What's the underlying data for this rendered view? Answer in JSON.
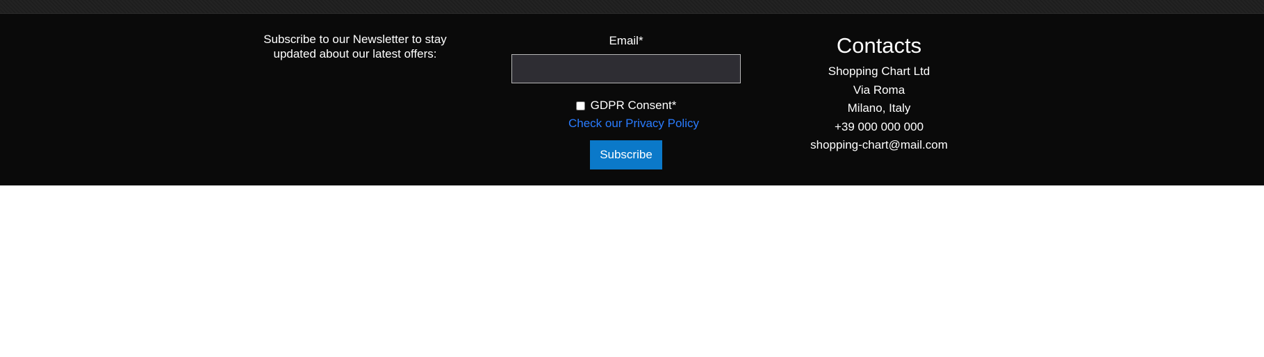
{
  "newsletter": {
    "text": "Subscribe to our Newsletter to stay updated about our latest offers:"
  },
  "form": {
    "email_label": "Email*",
    "email_value": "",
    "email_placeholder": "",
    "consent_label": "GDPR Consent*",
    "privacy_link": "Check our Privacy Policy",
    "subscribe_label": "Subscribe"
  },
  "contacts": {
    "title": "Contacts",
    "lines": [
      "Shopping Chart Ltd",
      "Via Roma",
      "Milano, Italy",
      "+39 000 000 000",
      "shopping-chart@mail.com"
    ]
  },
  "colors": {
    "footer_bg": "#0a0a0a",
    "input_bg": "#2e2d33",
    "link": "#2a7cff",
    "button": "#0b79c9"
  }
}
